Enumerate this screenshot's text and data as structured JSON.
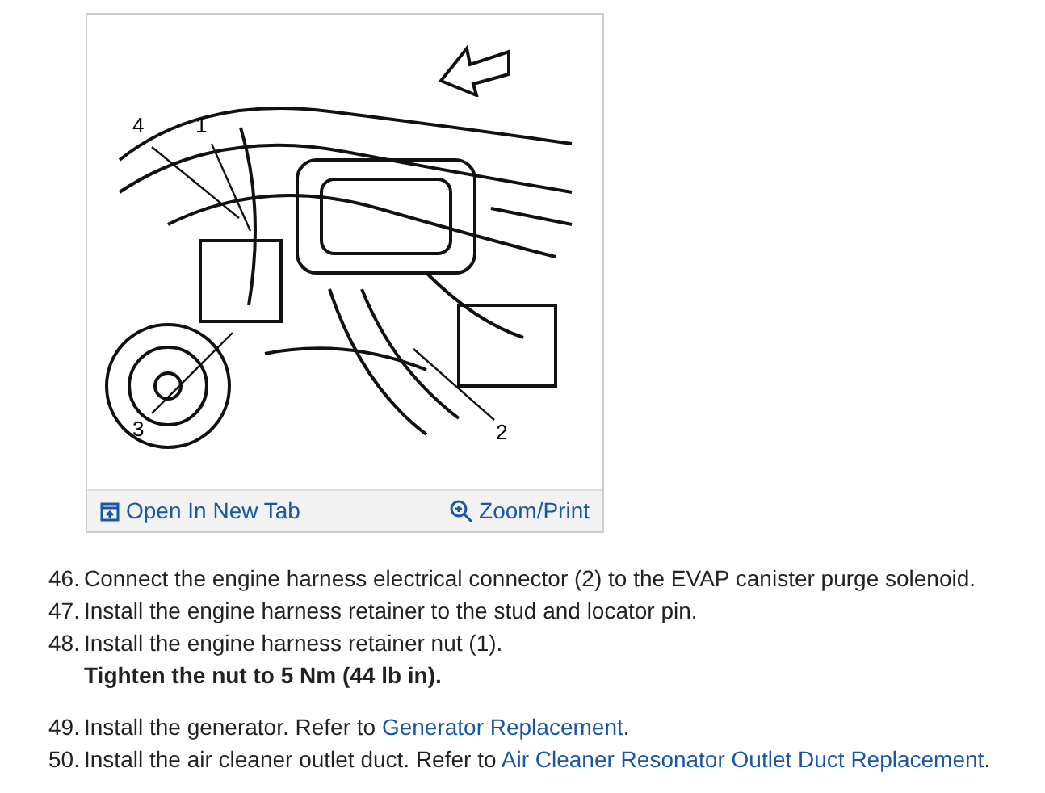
{
  "figure": {
    "callouts": [
      {
        "label": "4"
      },
      {
        "label": "1"
      },
      {
        "label": "3"
      },
      {
        "label": "2"
      }
    ],
    "links": [
      {
        "kind": "tab",
        "label": "Open In New Tab"
      },
      {
        "kind": "zoom",
        "label": "Zoom/Print"
      }
    ]
  },
  "steps": [
    {
      "number": "46.",
      "text": "Connect the engine harness electrical connector (2) to the EVAP canister purge solenoid."
    },
    {
      "number": "47.",
      "text": "Install the engine harness retainer to the stud and locator pin."
    },
    {
      "number": "48.",
      "text": "Install the engine harness retainer nut (1).",
      "note": "Tighten the nut to 5 Nm (44 lb in)."
    },
    {
      "number": "49.",
      "text": "Install the generator. Refer to ",
      "link": "Generator Replacement",
      "after": "."
    },
    {
      "number": "50.",
      "text": "Install the air cleaner outlet duct. Refer to ",
      "link": "Air Cleaner Resonator Outlet Duct Replacement",
      "after": "."
    }
  ]
}
